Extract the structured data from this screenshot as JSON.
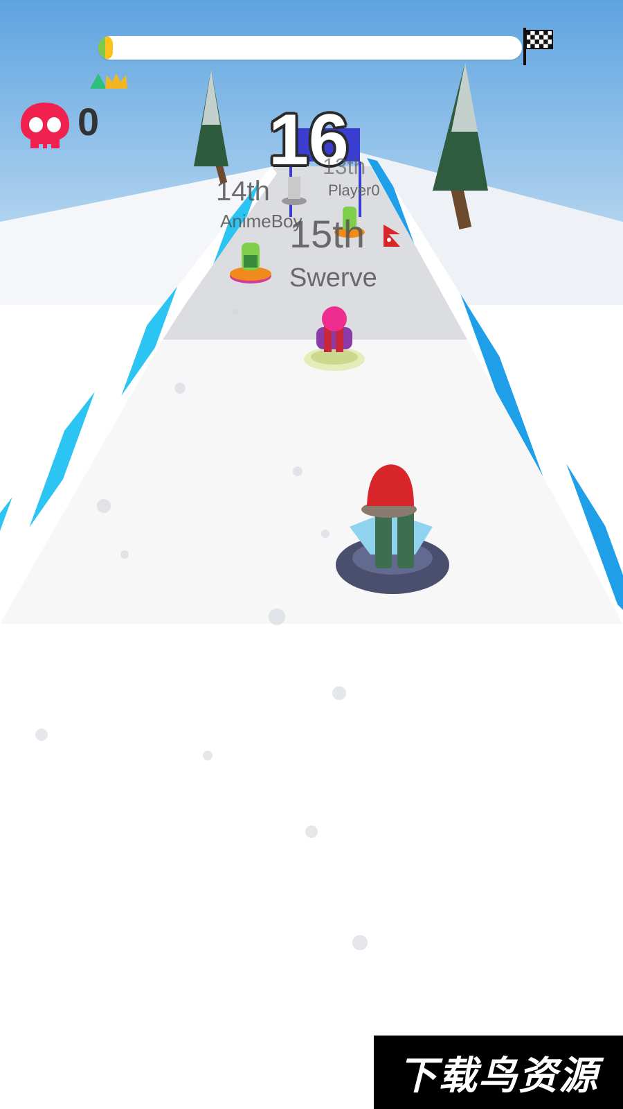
{
  "hud": {
    "progress_fraction": 0.035,
    "kill_count": "0",
    "current_rank": "16",
    "finish_icon": "checkered-flag-icon",
    "kill_icon": "skull-icon",
    "rank_icon": "crown-icon"
  },
  "racers": [
    {
      "place": "13th",
      "name": "Player0"
    },
    {
      "place": "14th",
      "name": "AnimeBoy"
    },
    {
      "place": "15th",
      "name": "Swerve"
    }
  ],
  "watermark": {
    "text": "下载鸟资源"
  },
  "colors": {
    "sky": "#7fb6e6",
    "progress_fill": "#ffc21a",
    "skull": "#f0204f",
    "barrier_blue": "#2cc4f2",
    "player_hat": "#d8262b"
  }
}
